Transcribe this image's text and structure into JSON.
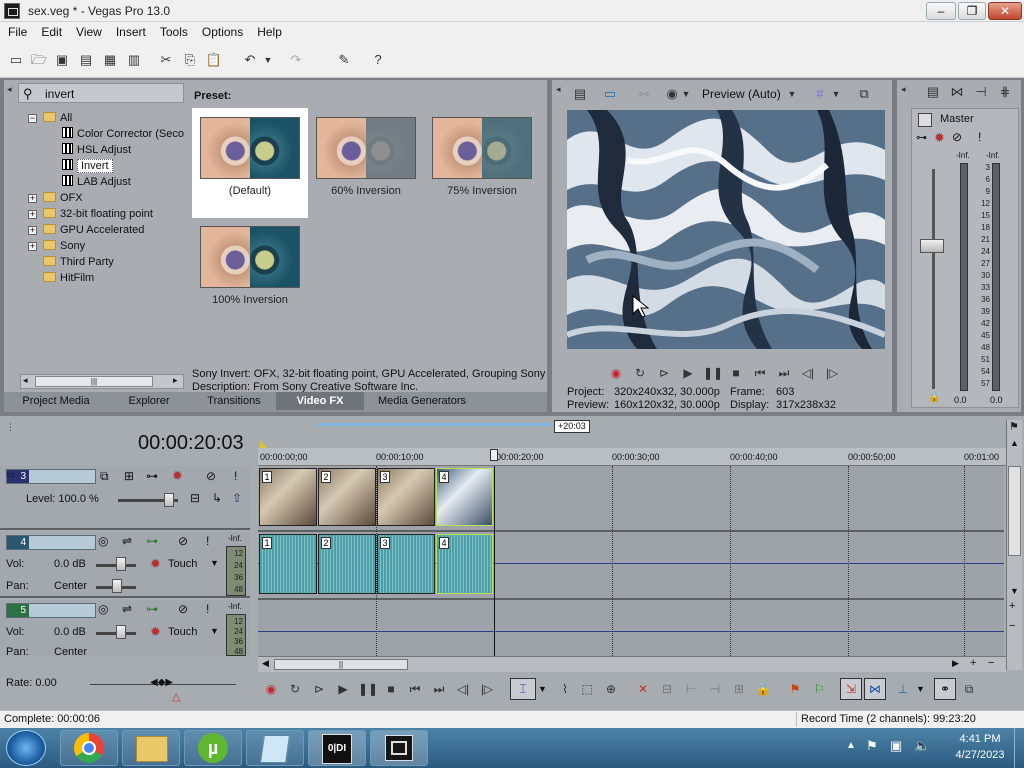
{
  "window": {
    "title": "sex.veg * - Vegas Pro 13.0"
  },
  "menu": [
    "File",
    "Edit",
    "View",
    "Insert",
    "Tools",
    "Options",
    "Help"
  ],
  "fx_browser": {
    "search_value": "invert",
    "tree": [
      {
        "label": "All",
        "type": "folder-open"
      },
      {
        "label": "Color Corrector (Seco",
        "type": "fx"
      },
      {
        "label": "HSL Adjust",
        "type": "fx"
      },
      {
        "label": "Invert",
        "type": "fx",
        "selected": true
      },
      {
        "label": "LAB Adjust",
        "type": "fx"
      },
      {
        "label": "OFX",
        "type": "folder"
      },
      {
        "label": "32-bit floating point",
        "type": "folder"
      },
      {
        "label": "GPU Accelerated",
        "type": "folder"
      },
      {
        "label": "Sony",
        "type": "folder"
      },
      {
        "label": "Third Party",
        "type": "folder-leaf"
      },
      {
        "label": "HitFilm",
        "type": "folder-leaf"
      }
    ],
    "preset_label": "Preset:",
    "presets": [
      "(Default)",
      "60% Inversion",
      "75% Inversion",
      "100% Inversion"
    ],
    "desc_line1": "Sony Invert: OFX, 32-bit floating point, GPU Accelerated, Grouping Sony",
    "desc_line2": "Description: From Sony Creative Software Inc."
  },
  "dock_tabs": [
    "Project Media",
    "Explorer",
    "Transitions",
    "Video FX",
    "Media Generators"
  ],
  "preview": {
    "mode": "Preview (Auto)",
    "project_label": "Project:",
    "project_value": "320x240x32, 30.000p",
    "frame_label": "Frame:",
    "frame_value": "603",
    "preview_label": "Preview:",
    "preview_value": "160x120x32, 30.000p",
    "display_label": "Display:",
    "display_value": "317x238x32"
  },
  "master": {
    "title": "Master",
    "inf_left": "-Inf.",
    "inf_right": "-Inf.",
    "scale": [
      "3",
      "6",
      "9",
      "12",
      "15",
      "18",
      "21",
      "24",
      "27",
      "30",
      "33",
      "36",
      "39",
      "42",
      "45",
      "48",
      "51",
      "54",
      "57"
    ],
    "bottom_left": "0.0",
    "bottom_right": "0.0"
  },
  "timeline": {
    "timecode": "00:00:20:03",
    "loop_label": "+20:03",
    "ruler": [
      "00:00:00;00",
      "00:00:10;00",
      "00:00:20;00",
      "00:00:30;00",
      "00:00:40;00",
      "00:00:50;00",
      "00:01:00"
    ],
    "tracks": {
      "t3": {
        "num": "3",
        "level_label": "Level: 100.0 %"
      },
      "t4": {
        "num": "4",
        "vol_label": "Vol:",
        "vol_value": "0.0 dB",
        "pan_label": "Pan:",
        "pan_value": "Center",
        "mode": "Touch",
        "inf": "-Inf.",
        "meter": [
          "12",
          "24",
          "36",
          "48"
        ]
      },
      "t5": {
        "num": "5",
        "vol_label": "Vol:",
        "vol_value": "0.0 dB",
        "pan_label": "Pan:",
        "pan_value": "Center",
        "mode": "Touch",
        "inf": "-Inf.",
        "meter": [
          "12",
          "24",
          "36",
          "48"
        ]
      }
    },
    "clip_numbers": [
      "1",
      "2",
      "3",
      "4"
    ]
  },
  "rate": {
    "label": "Rate: 0.00"
  },
  "status": {
    "left": "Complete: 00:00:06",
    "right": "Record Time (2 channels): 99:23:20"
  },
  "clock": {
    "time": "4:41 PM",
    "date": "4/27/2023"
  },
  "colors": {
    "track_blue": "#2c3f8a",
    "audio_wave": "#4f9ea6",
    "selection_green": "#b6e35a"
  }
}
